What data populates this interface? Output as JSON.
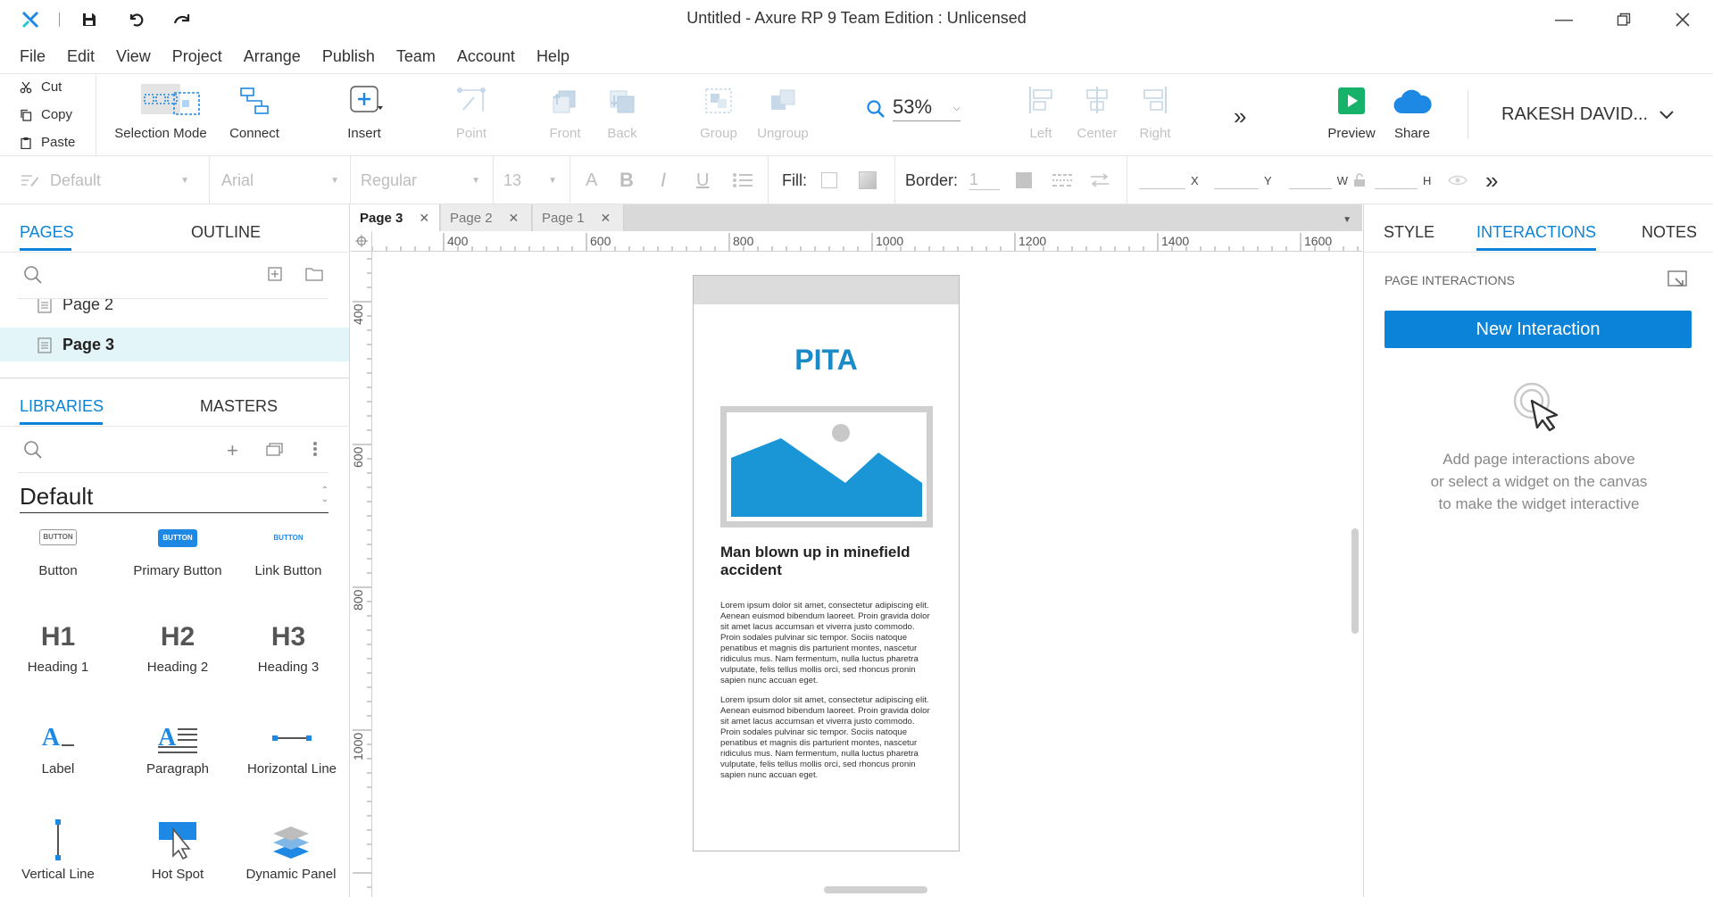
{
  "titlebar": {
    "title": "Untitled - Axure RP 9 Team Edition : Unlicensed"
  },
  "menu": [
    "File",
    "Edit",
    "View",
    "Project",
    "Arrange",
    "Publish",
    "Team",
    "Account",
    "Help"
  ],
  "clipboard": {
    "cut": "Cut",
    "copy": "Copy",
    "paste": "Paste"
  },
  "toolbar": {
    "selection_mode": "Selection Mode",
    "connect": "Connect",
    "insert": "Insert",
    "point": "Point",
    "front": "Front",
    "back": "Back",
    "group": "Group",
    "ungroup": "Ungroup",
    "zoom": "53%",
    "left": "Left",
    "center": "Center",
    "right": "Right",
    "preview": "Preview",
    "share": "Share",
    "user": "RAKESH DAVID..."
  },
  "formatbar": {
    "style": "Default",
    "font": "Arial",
    "weight": "Regular",
    "size": "13",
    "fill_label": "Fill:",
    "border_label": "Border:",
    "border_value": "1",
    "x": "X",
    "y": "Y",
    "w": "W",
    "h": "H"
  },
  "left_panel": {
    "tabs": [
      "PAGES",
      "OUTLINE"
    ],
    "pages": [
      "Page 2",
      "Page 3"
    ],
    "lib_tabs": [
      "LIBRARIES",
      "MASTERS"
    ],
    "library_name": "Default",
    "widgets": [
      "Button",
      "Primary Button",
      "Link Button",
      "Heading 1",
      "Heading 2",
      "Heading 3",
      "Label",
      "Paragraph",
      "Horizontal Line",
      "Vertical Line",
      "Hot Spot",
      "Dynamic Panel"
    ],
    "widget_glyphs": {
      "button": "BUTTON",
      "h1": "H1",
      "h2": "H2",
      "h3": "H3",
      "label": "A"
    }
  },
  "canvas": {
    "tabs": [
      "Page 3",
      "Page 2",
      "Page 1"
    ],
    "ruler_h": [
      "400",
      "600",
      "800",
      "1000",
      "1200",
      "1400",
      "1600"
    ],
    "ruler_v": [
      "400",
      "600",
      "800",
      "1000"
    ],
    "mock": {
      "brand": "PITA",
      "headline": "Man blown up in minefield accident",
      "paragraph": "Lorem ipsum dolor sit amet, consectetur adipiscing elit. Aenean euismod bibendum laoreet. Proin gravida dolor sit amet lacus accumsan et viverra justo commodo. Proin sodales pulvinar sic tempor. Sociis natoque penatibus et magnis dis parturient montes, nascetur ridiculus mus. Nam fermentum, nulla luctus pharetra vulputate, felis tellus mollis orci, sed rhoncus pronin sapien nunc accuan eget."
    }
  },
  "right_panel": {
    "tabs": [
      "STYLE",
      "INTERACTIONS",
      "NOTES"
    ],
    "section": "PAGE INTERACTIONS",
    "new_interaction": "New Interaction",
    "help_lines": [
      "Add page interactions above",
      "or select a widget on the canvas",
      "to make the widget interactive"
    ]
  },
  "colors": {
    "accent": "#0b83d9",
    "brand_blue": "#1a8ac9",
    "preview_green": "#17b26a"
  }
}
